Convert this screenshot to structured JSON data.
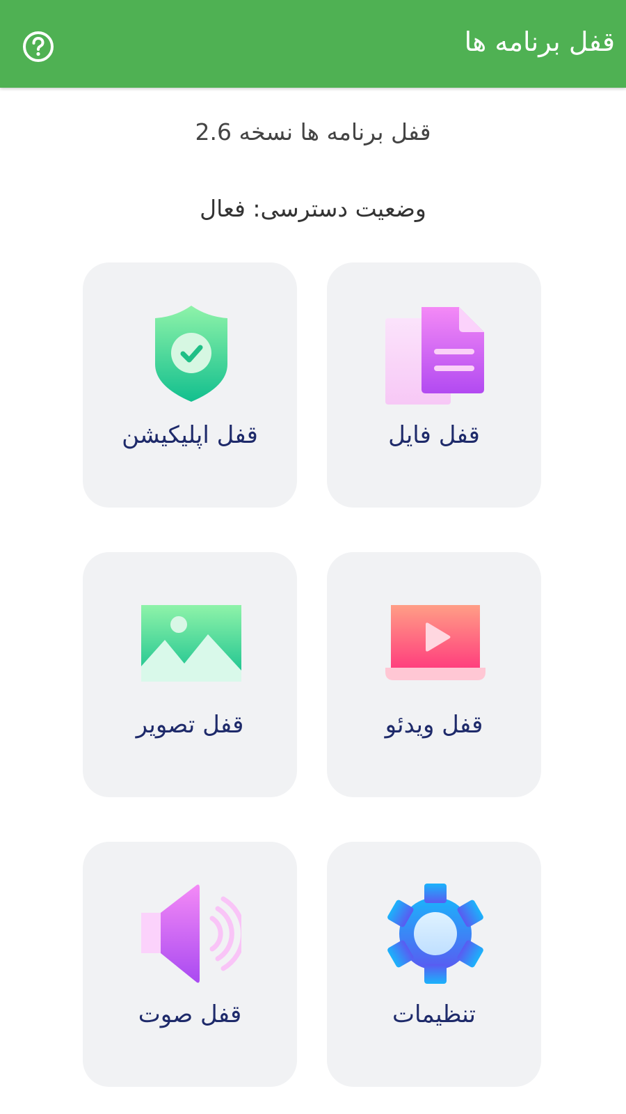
{
  "appbar": {
    "title": "قفل برنامه ها",
    "help_icon": "help-circle-icon",
    "color": "#4fb153"
  },
  "info": {
    "version_text": "قفل برنامه ها نسخه 2.6",
    "status_text": "وضعیت دسترسی: فعال"
  },
  "tiles": [
    {
      "label": "قفل فایل",
      "icon": "document-icon"
    },
    {
      "label": "قفل اپلیکیشن",
      "icon": "shield-check-icon"
    },
    {
      "label": "قفل ویدئو",
      "icon": "video-play-icon"
    },
    {
      "label": "قفل تصویر",
      "icon": "image-icon"
    },
    {
      "label": "تنظیمات",
      "icon": "gear-icon"
    },
    {
      "label": "قفل صوت",
      "icon": "speaker-icon"
    }
  ]
}
